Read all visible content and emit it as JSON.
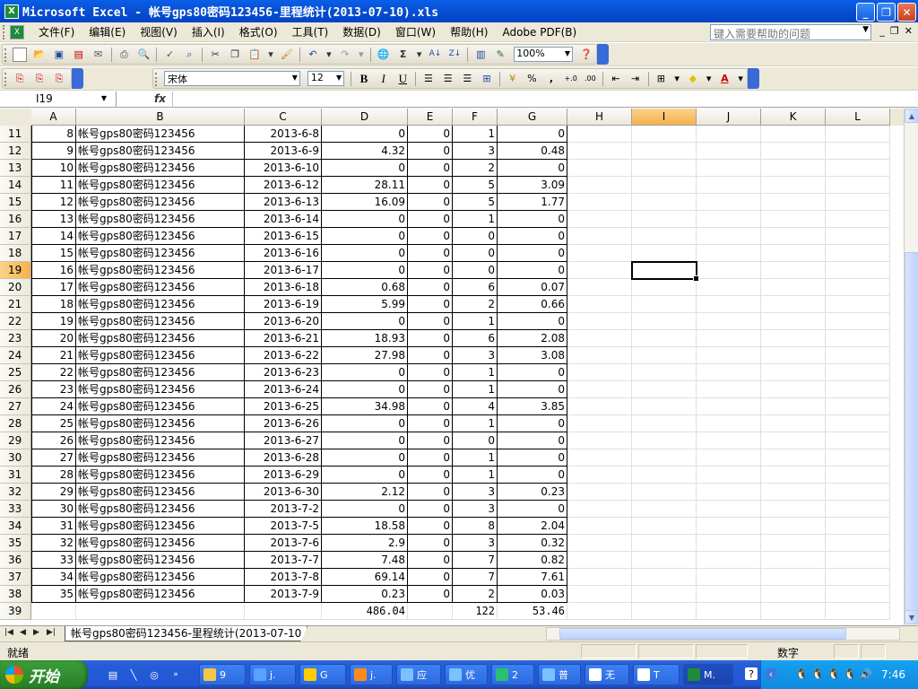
{
  "window": {
    "title": "Microsoft Excel - 帐号gps80密码123456-里程统计(2013-07-10).xls",
    "app_icon": "excel-icon"
  },
  "menu": {
    "items": [
      "文件(F)",
      "编辑(E)",
      "视图(V)",
      "插入(I)",
      "格式(O)",
      "工具(T)",
      "数据(D)",
      "窗口(W)",
      "帮助(H)",
      "Adobe PDF(B)"
    ],
    "help_placeholder": "键入需要帮助的问题"
  },
  "toolbar": {
    "zoom": "100%",
    "font": "宋体",
    "size": "12"
  },
  "formula_bar": {
    "name_box": "I19",
    "fx": "fx",
    "content": ""
  },
  "columns": [
    "A",
    "B",
    "C",
    "D",
    "E",
    "F",
    "G",
    "H",
    "I",
    "J",
    "K",
    "L"
  ],
  "selected": {
    "column": "I",
    "row": "19"
  },
  "rows": [
    {
      "n": "11",
      "a": "8",
      "b": "帐号gps80密码123456",
      "c": "2013-6-8",
      "d": "0",
      "e": "0",
      "f": "1",
      "g": "0"
    },
    {
      "n": "12",
      "a": "9",
      "b": "帐号gps80密码123456",
      "c": "2013-6-9",
      "d": "4.32",
      "e": "0",
      "f": "3",
      "g": "0.48"
    },
    {
      "n": "13",
      "a": "10",
      "b": "帐号gps80密码123456",
      "c": "2013-6-10",
      "d": "0",
      "e": "0",
      "f": "2",
      "g": "0"
    },
    {
      "n": "14",
      "a": "11",
      "b": "帐号gps80密码123456",
      "c": "2013-6-12",
      "d": "28.11",
      "e": "0",
      "f": "5",
      "g": "3.09"
    },
    {
      "n": "15",
      "a": "12",
      "b": "帐号gps80密码123456",
      "c": "2013-6-13",
      "d": "16.09",
      "e": "0",
      "f": "5",
      "g": "1.77"
    },
    {
      "n": "16",
      "a": "13",
      "b": "帐号gps80密码123456",
      "c": "2013-6-14",
      "d": "0",
      "e": "0",
      "f": "1",
      "g": "0"
    },
    {
      "n": "17",
      "a": "14",
      "b": "帐号gps80密码123456",
      "c": "2013-6-15",
      "d": "0",
      "e": "0",
      "f": "0",
      "g": "0"
    },
    {
      "n": "18",
      "a": "15",
      "b": "帐号gps80密码123456",
      "c": "2013-6-16",
      "d": "0",
      "e": "0",
      "f": "0",
      "g": "0"
    },
    {
      "n": "19",
      "a": "16",
      "b": "帐号gps80密码123456",
      "c": "2013-6-17",
      "d": "0",
      "e": "0",
      "f": "0",
      "g": "0"
    },
    {
      "n": "20",
      "a": "17",
      "b": "帐号gps80密码123456",
      "c": "2013-6-18",
      "d": "0.68",
      "e": "0",
      "f": "6",
      "g": "0.07"
    },
    {
      "n": "21",
      "a": "18",
      "b": "帐号gps80密码123456",
      "c": "2013-6-19",
      "d": "5.99",
      "e": "0",
      "f": "2",
      "g": "0.66"
    },
    {
      "n": "22",
      "a": "19",
      "b": "帐号gps80密码123456",
      "c": "2013-6-20",
      "d": "0",
      "e": "0",
      "f": "1",
      "g": "0"
    },
    {
      "n": "23",
      "a": "20",
      "b": "帐号gps80密码123456",
      "c": "2013-6-21",
      "d": "18.93",
      "e": "0",
      "f": "6",
      "g": "2.08"
    },
    {
      "n": "24",
      "a": "21",
      "b": "帐号gps80密码123456",
      "c": "2013-6-22",
      "d": "27.98",
      "e": "0",
      "f": "3",
      "g": "3.08"
    },
    {
      "n": "25",
      "a": "22",
      "b": "帐号gps80密码123456",
      "c": "2013-6-23",
      "d": "0",
      "e": "0",
      "f": "1",
      "g": "0"
    },
    {
      "n": "26",
      "a": "23",
      "b": "帐号gps80密码123456",
      "c": "2013-6-24",
      "d": "0",
      "e": "0",
      "f": "1",
      "g": "0"
    },
    {
      "n": "27",
      "a": "24",
      "b": "帐号gps80密码123456",
      "c": "2013-6-25",
      "d": "34.98",
      "e": "0",
      "f": "4",
      "g": "3.85"
    },
    {
      "n": "28",
      "a": "25",
      "b": "帐号gps80密码123456",
      "c": "2013-6-26",
      "d": "0",
      "e": "0",
      "f": "1",
      "g": "0"
    },
    {
      "n": "29",
      "a": "26",
      "b": "帐号gps80密码123456",
      "c": "2013-6-27",
      "d": "0",
      "e": "0",
      "f": "0",
      "g": "0"
    },
    {
      "n": "30",
      "a": "27",
      "b": "帐号gps80密码123456",
      "c": "2013-6-28",
      "d": "0",
      "e": "0",
      "f": "1",
      "g": "0"
    },
    {
      "n": "31",
      "a": "28",
      "b": "帐号gps80密码123456",
      "c": "2013-6-29",
      "d": "0",
      "e": "0",
      "f": "1",
      "g": "0"
    },
    {
      "n": "32",
      "a": "29",
      "b": "帐号gps80密码123456",
      "c": "2013-6-30",
      "d": "2.12",
      "e": "0",
      "f": "3",
      "g": "0.23"
    },
    {
      "n": "33",
      "a": "30",
      "b": "帐号gps80密码123456",
      "c": "2013-7-2",
      "d": "0",
      "e": "0",
      "f": "3",
      "g": "0"
    },
    {
      "n": "34",
      "a": "31",
      "b": "帐号gps80密码123456",
      "c": "2013-7-5",
      "d": "18.58",
      "e": "0",
      "f": "8",
      "g": "2.04"
    },
    {
      "n": "35",
      "a": "32",
      "b": "帐号gps80密码123456",
      "c": "2013-7-6",
      "d": "2.9",
      "e": "0",
      "f": "3",
      "g": "0.32"
    },
    {
      "n": "36",
      "a": "33",
      "b": "帐号gps80密码123456",
      "c": "2013-7-7",
      "d": "7.48",
      "e": "0",
      "f": "7",
      "g": "0.82"
    },
    {
      "n": "37",
      "a": "34",
      "b": "帐号gps80密码123456",
      "c": "2013-7-8",
      "d": "69.14",
      "e": "0",
      "f": "7",
      "g": "7.61"
    },
    {
      "n": "38",
      "a": "35",
      "b": "帐号gps80密码123456",
      "c": "2013-7-9",
      "d": "0.23",
      "e": "0",
      "f": "2",
      "g": "0.03"
    }
  ],
  "totals": {
    "n": "39",
    "d": "486.04",
    "f": "122",
    "g": "53.46"
  },
  "sheet_tab": "帐号gps80密码123456-里程统计(2013-07-10",
  "status": {
    "text": "就绪",
    "mode": "数字"
  },
  "taskbar": {
    "start": "开始",
    "tasks": [
      {
        "label": "9",
        "icon": "folder-icon"
      },
      {
        "label": "j.",
        "icon": "globe-icon"
      },
      {
        "label": "G",
        "icon": "qq-icon"
      },
      {
        "label": "j.",
        "icon": "firefox-icon"
      },
      {
        "label": "应",
        "icon": "app-icon"
      },
      {
        "label": "优",
        "icon": "app-icon"
      },
      {
        "label": "2",
        "icon": "chat-icon"
      },
      {
        "label": "普",
        "icon": "app-icon"
      },
      {
        "label": "无",
        "icon": "doc-icon"
      },
      {
        "label": "T",
        "icon": "doc-icon"
      },
      {
        "label": "M.",
        "icon": "excel-icon"
      }
    ],
    "clock": "7:46"
  }
}
